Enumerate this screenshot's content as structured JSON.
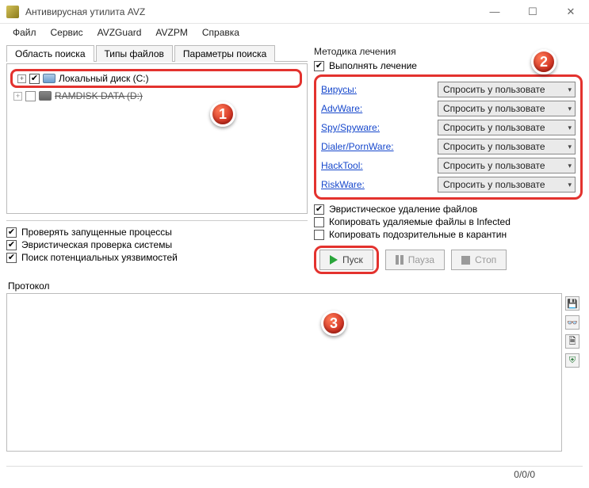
{
  "window": {
    "title": "Антивирусная утилита AVZ"
  },
  "menu": {
    "file": "Файл",
    "service": "Сервис",
    "avzguard": "AVZGuard",
    "avzpm": "AVZPM",
    "help": "Справка"
  },
  "left": {
    "tabs": {
      "scope": "Область поиска",
      "filetypes": "Типы файлов",
      "params": "Параметры поиска"
    },
    "drives": [
      {
        "label": "Локальный диск (C:)",
        "checked": true
      },
      {
        "label": "RAMDISK DATA (D:)",
        "checked": false
      }
    ],
    "options": {
      "running": "Проверять запущенные процессы",
      "heuristic": "Эвристическая проверка системы",
      "vuln": "Поиск потенциальных уязвимостей"
    }
  },
  "right": {
    "title": "Методика лечения",
    "perform": "Выполнять лечение",
    "threats": [
      {
        "name": "Вирусы:",
        "action": "Спросить у пользовате"
      },
      {
        "name": "AdvWare:",
        "action": "Спросить у пользовате"
      },
      {
        "name": "Spy/Spyware:",
        "action": "Спросить у пользовате"
      },
      {
        "name": "Dialer/PornWare:",
        "action": "Спросить у пользовате"
      },
      {
        "name": "HackTool:",
        "action": "Спросить у пользовате"
      },
      {
        "name": "RiskWare:",
        "action": "Спросить у пользовате"
      }
    ],
    "extra": {
      "heurdel": "Эвристическое удаление файлов",
      "copyinf": "Копировать удаляемые файлы в Infected",
      "copyquar": "Копировать подозрительные в карантин"
    },
    "buttons": {
      "start": "Пуск",
      "pause": "Пауза",
      "stop": "Стоп"
    }
  },
  "protocol": {
    "label": "Протокол"
  },
  "status": {
    "counter": "0/0/0"
  },
  "callouts": {
    "one": "1",
    "two": "2",
    "three": "3"
  }
}
